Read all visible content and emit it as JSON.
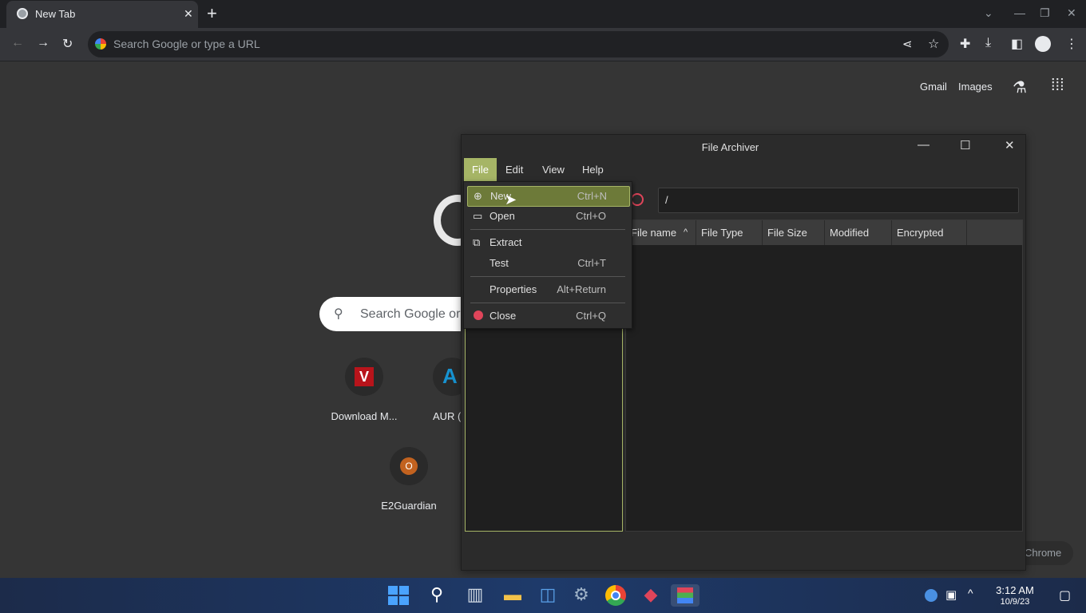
{
  "browser": {
    "tab_title": "New Tab",
    "tab_close": "✕",
    "new_tab": "+",
    "omnibox_placeholder": "Search Google or type a URL",
    "window_controls": [
      "⌄",
      "—",
      "❐",
      "✕"
    ]
  },
  "ntp": {
    "gmail": "Gmail",
    "images": "Images",
    "search_placeholder": "Search Google or",
    "shortcuts": [
      {
        "label": "Download M...",
        "letter": "V"
      },
      {
        "label": "AUR (",
        "letter": "A"
      },
      {
        "label": "E2Guardian",
        "letter": "O"
      }
    ],
    "customize_chip": "Chrome"
  },
  "file_archiver": {
    "title": "File Archiver",
    "menus": [
      "File",
      "Edit",
      "View",
      "Help"
    ],
    "path": "/",
    "columns": [
      "File name",
      "File Type",
      "File Size",
      "Modified",
      "Encrypted"
    ],
    "file_menu": [
      {
        "label": "New",
        "shortcut": "Ctrl+N",
        "icon": "new-archive-icon"
      },
      {
        "label": "Open",
        "shortcut": "Ctrl+O",
        "icon": "folder-icon"
      },
      {
        "label": "Extract",
        "shortcut": "",
        "icon": "extract-icon"
      },
      {
        "label": "Test",
        "shortcut": "Ctrl+T",
        "icon": ""
      },
      {
        "label": "Properties",
        "shortcut": "Alt+Return",
        "icon": ""
      },
      {
        "label": "Close",
        "shortcut": "Ctrl+Q",
        "icon": "close-circle-icon"
      }
    ]
  },
  "taskbar": {
    "time": "3:12 AM",
    "date": "10/9/23"
  },
  "colors": {
    "accent": "#a6b566",
    "menu_highlight": "#6d7a39",
    "close_red": "#e0455a"
  }
}
